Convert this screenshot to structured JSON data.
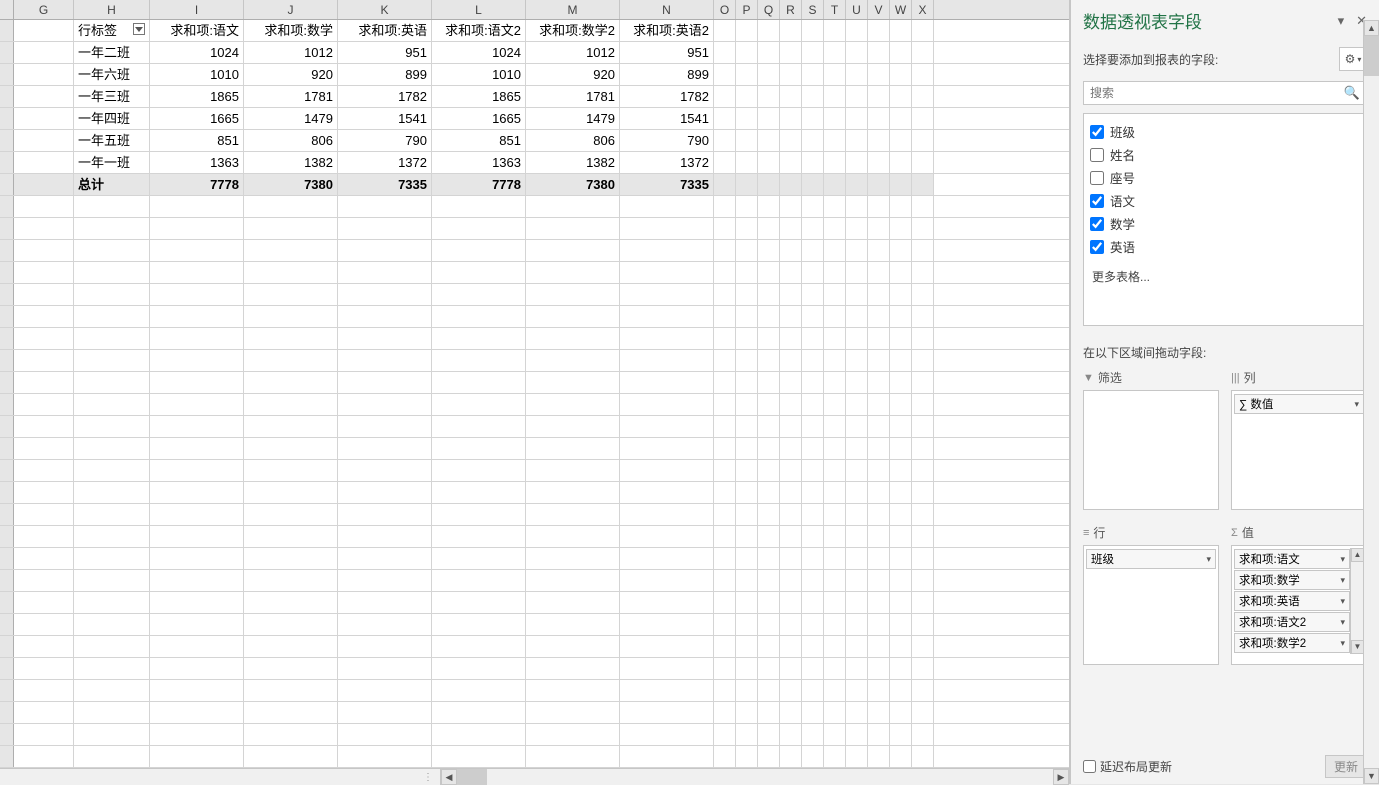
{
  "columns": [
    "G",
    "H",
    "I",
    "J",
    "K",
    "L",
    "M",
    "N",
    "O",
    "P",
    "Q",
    "R",
    "S",
    "T",
    "U",
    "V",
    "W",
    "X"
  ],
  "pivot": {
    "row_label_header": "行标签",
    "value_headers": [
      "求和项:语文",
      "求和项:数学",
      "求和项:英语",
      "求和项:语文2",
      "求和项:数学2",
      "求和项:英语2"
    ],
    "rows": [
      {
        "label": "一年二班",
        "vals": [
          1024,
          1012,
          951,
          1024,
          1012,
          951
        ]
      },
      {
        "label": "一年六班",
        "vals": [
          1010,
          920,
          899,
          1010,
          920,
          899
        ]
      },
      {
        "label": "一年三班",
        "vals": [
          1865,
          1781,
          1782,
          1865,
          1781,
          1782
        ]
      },
      {
        "label": "一年四班",
        "vals": [
          1665,
          1479,
          1541,
          1665,
          1479,
          1541
        ]
      },
      {
        "label": "一年五班",
        "vals": [
          851,
          806,
          790,
          851,
          806,
          790
        ]
      },
      {
        "label": "一年一班",
        "vals": [
          1363,
          1382,
          1372,
          1363,
          1382,
          1372
        ]
      }
    ],
    "total_label": "总计",
    "totals": [
      7778,
      7380,
      7335,
      7778,
      7380,
      7335
    ]
  },
  "panel": {
    "title": "数据透视表字段",
    "choose_fields": "选择要添加到报表的字段:",
    "search_placeholder": "搜索",
    "fields": [
      {
        "name": "班级",
        "checked": true
      },
      {
        "name": "姓名",
        "checked": false
      },
      {
        "name": "座号",
        "checked": false
      },
      {
        "name": "语文",
        "checked": true
      },
      {
        "name": "数学",
        "checked": true
      },
      {
        "name": "英语",
        "checked": true
      }
    ],
    "more_tables": "更多表格...",
    "drag_hint": "在以下区域间拖动字段:",
    "area_filter": "筛选",
    "area_columns": "列",
    "area_rows": "行",
    "area_values": "值",
    "col_item": "∑ 数值",
    "row_item": "班级",
    "value_items": [
      "求和项:语文",
      "求和项:数学",
      "求和项:英语",
      "求和项:语文2",
      "求和项:数学2"
    ],
    "defer_layout": "延迟布局更新",
    "update_btn": "更新"
  }
}
